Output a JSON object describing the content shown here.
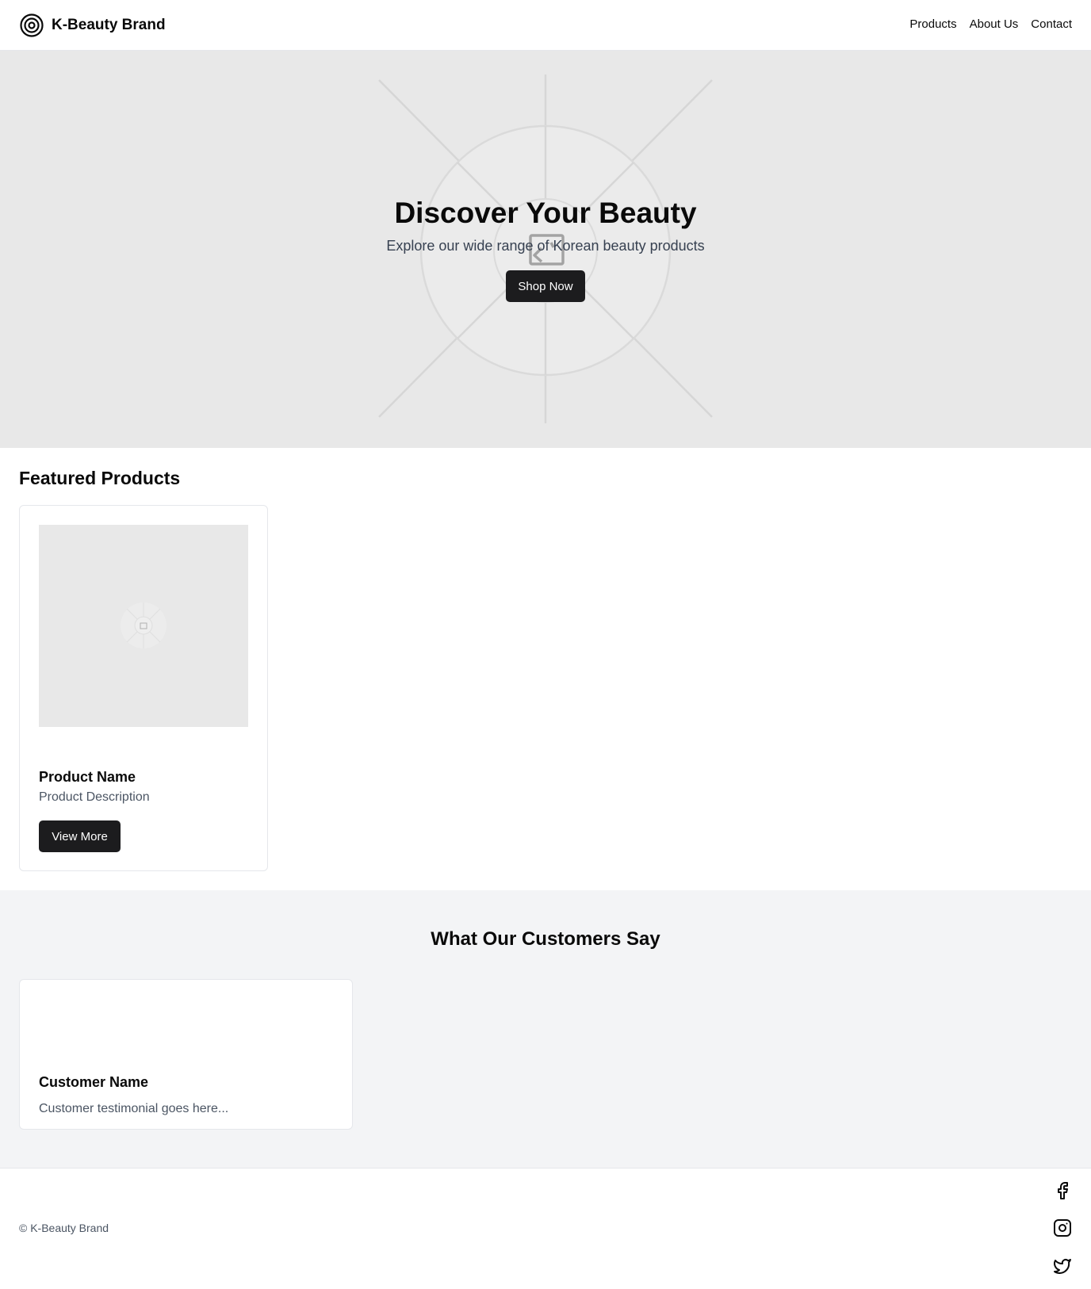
{
  "header": {
    "brand_name": "K-Beauty Brand",
    "brand_icon": "target-icon",
    "nav": [
      {
        "label": "Products"
      },
      {
        "label": "About Us"
      },
      {
        "label": "Contact"
      }
    ]
  },
  "hero": {
    "title": "Discover Your Beauty",
    "subtitle": "Explore our wide range of Korean beauty products",
    "cta_label": "Shop Now",
    "background_icon": "image-placeholder-icon"
  },
  "featured": {
    "title": "Featured Products",
    "products": [
      {
        "name": "Product Name",
        "description": "Product Description",
        "button_label": "View More",
        "image_icon": "image-placeholder-icon"
      }
    ]
  },
  "testimonials": {
    "title": "What Our Customers Say",
    "items": [
      {
        "name": "Customer Name",
        "text": "Customer testimonial goes here..."
      }
    ]
  },
  "footer": {
    "copyright": "© K-Beauty Brand",
    "social_icons": [
      "facebook-icon",
      "instagram-icon",
      "twitter-icon"
    ]
  },
  "colors": {
    "primary_button": "#1c1c1e",
    "hero_background": "#e8e8e8",
    "testimonials_background": "#f3f4f6",
    "border": "#e5e7eb",
    "muted_text": "#4b5563"
  }
}
